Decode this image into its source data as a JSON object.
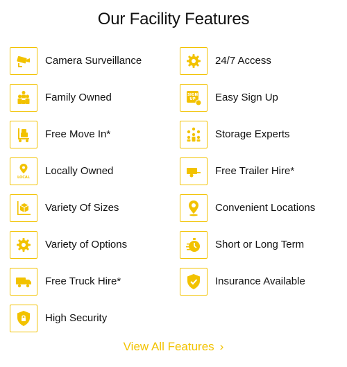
{
  "heading": "Our Facility Features",
  "accent_color": "#f2c200",
  "features": [
    {
      "label": "Camera Surveillance",
      "icon": "camera-icon"
    },
    {
      "label": "24/7 Access",
      "icon": "gear-icon"
    },
    {
      "label": "Family Owned",
      "icon": "family-icon"
    },
    {
      "label": "Easy Sign Up",
      "icon": "sign-up-icon"
    },
    {
      "label": "Free Move In*",
      "icon": "dolly-icon"
    },
    {
      "label": "Storage Experts",
      "icon": "team-icon"
    },
    {
      "label": "Locally Owned",
      "icon": "local-pin-icon"
    },
    {
      "label": "Free Trailer Hire*",
      "icon": "trailer-icon"
    },
    {
      "label": "Variety Of Sizes",
      "icon": "box-sizes-icon"
    },
    {
      "label": "Convenient Locations",
      "icon": "location-pin-icon"
    },
    {
      "label": "Variety of Options",
      "icon": "options-gear-icon"
    },
    {
      "label": "Short or Long Term",
      "icon": "stopwatch-icon"
    },
    {
      "label": "Free Truck Hire*",
      "icon": "truck-icon"
    },
    {
      "label": "Insurance Available",
      "icon": "shield-check-icon"
    },
    {
      "label": "High Security",
      "icon": "lock-shield-icon"
    }
  ],
  "view_all": {
    "label": "View All Features",
    "chevron": "›"
  }
}
